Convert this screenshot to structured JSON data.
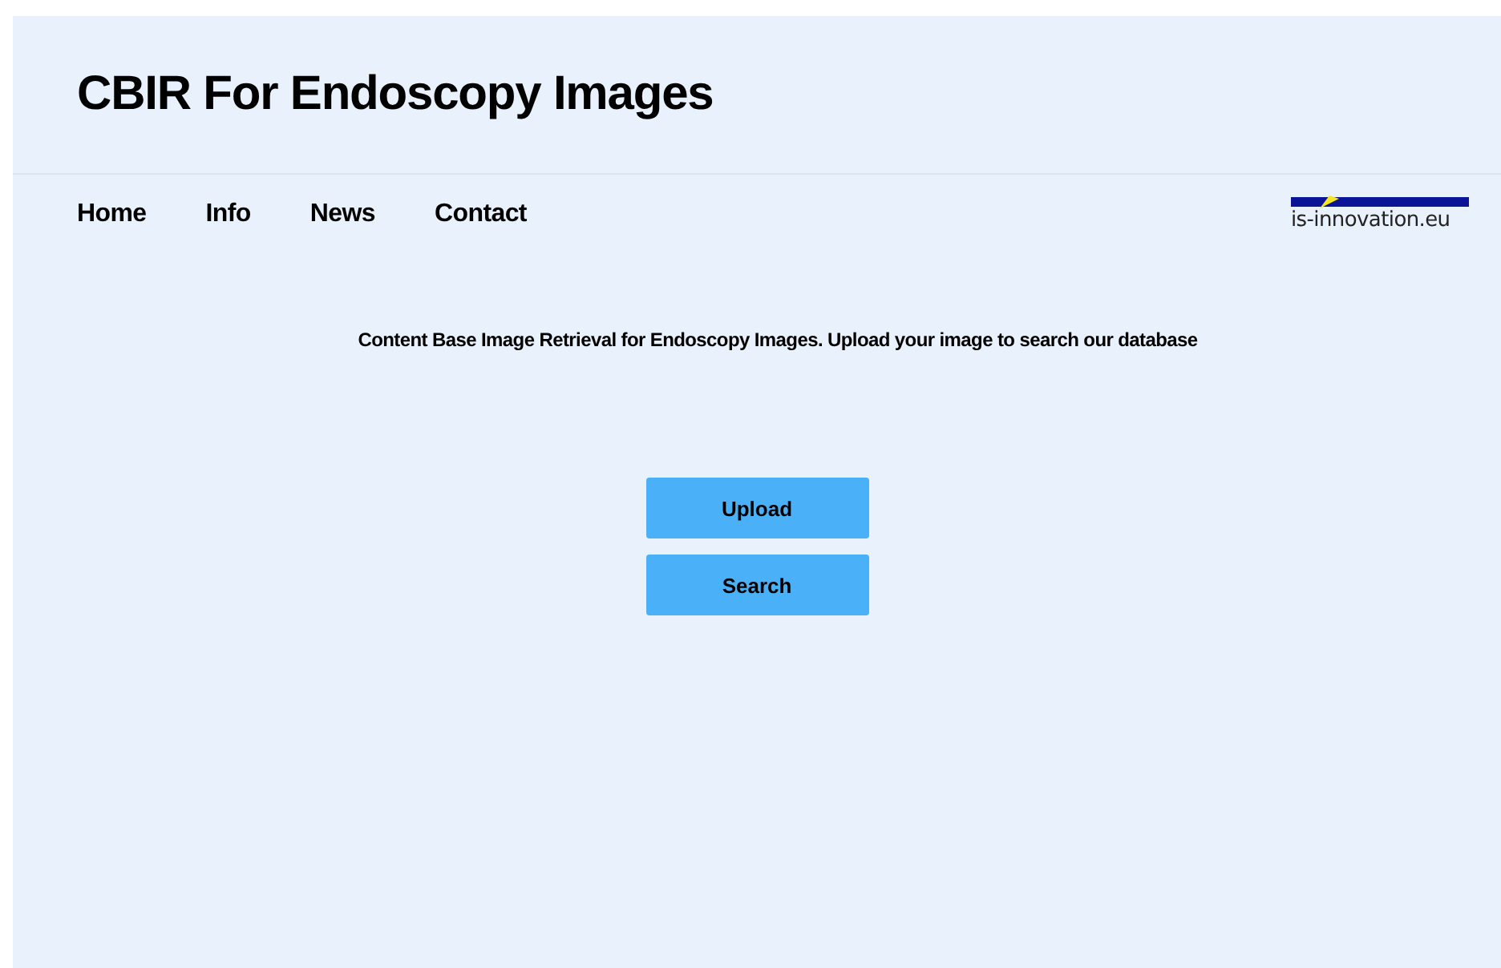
{
  "header": {
    "title": "CBIR For Endoscopy Images"
  },
  "nav": {
    "items": [
      {
        "label": "Home"
      },
      {
        "label": "Info"
      },
      {
        "label": "News"
      },
      {
        "label": "Contact"
      }
    ],
    "logo_text": "is-innovation.eu"
  },
  "intro": "Content Base Image Retrieval for Endoscopy Images. Upload your image to search our database",
  "buttons": [
    {
      "label": "Upload"
    },
    {
      "label": "Search"
    }
  ]
}
